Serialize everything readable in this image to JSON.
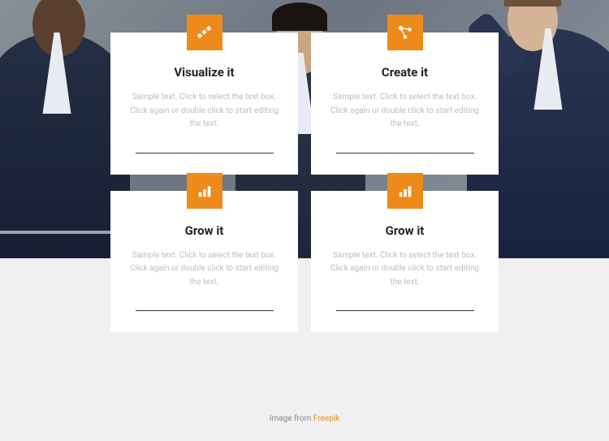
{
  "colors": {
    "accent": "#ed8a19"
  },
  "cards": [
    {
      "title": "Visualize it",
      "desc": "Sample text. Click to select the text box. Click again or double click to start editing the text.",
      "icon": "steps-icon"
    },
    {
      "title": "Create it",
      "desc": "Sample text. Click to select the text box. Click again or double click to start editing the text.",
      "icon": "connect-icon"
    },
    {
      "title": "Grow it",
      "desc": "Sample text. Click to select the text box. Click again or double click to start editing the text.",
      "icon": "chart-icon"
    },
    {
      "title": "Grow it",
      "desc": "Sample text. Click to select the text box. Click again or double click to start editing the text.",
      "icon": "chart-icon"
    }
  ],
  "credit": {
    "prefix": "Image from ",
    "link_text": "Freepik"
  }
}
